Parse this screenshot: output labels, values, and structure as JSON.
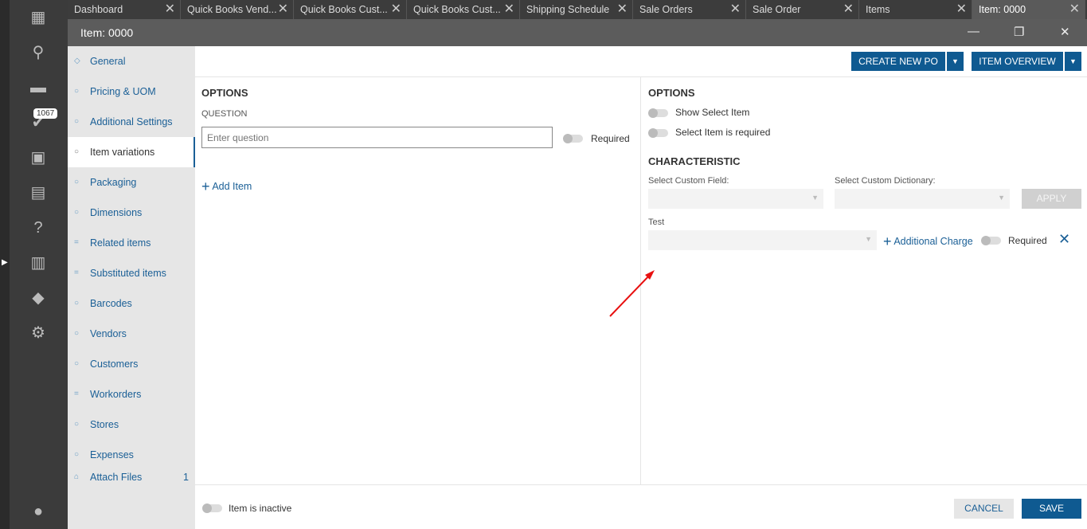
{
  "rail": {
    "badge": "1067"
  },
  "tabs": [
    "Dashboard",
    "Quick Books Vend...",
    "Quick Books Cust...",
    "Quick Books Cust...",
    "Shipping Schedule",
    "Sale Orders",
    "Sale Order",
    "Items",
    "Item: 0000"
  ],
  "window": {
    "title": "Item: 0000"
  },
  "nav": {
    "items": [
      "General",
      "Pricing & UOM",
      "Additional Settings",
      "Item variations",
      "Packaging",
      "Dimensions",
      "Related items",
      "Substituted items",
      "Barcodes",
      "Vendors",
      "Customers",
      "Workorders",
      "Stores",
      "Expenses",
      "Attach Files"
    ],
    "attach_count": "1"
  },
  "toolbar": {
    "create_po": "CREATE NEW PO",
    "item_overview": "ITEM OVERVIEW"
  },
  "left": {
    "heading": "OPTIONS",
    "question_label": "QUESTION",
    "question_placeholder": "Enter question",
    "required": "Required",
    "add_item": "Add Item"
  },
  "right": {
    "heading": "OPTIONS",
    "show_select": "Show Select Item",
    "select_required": "Select Item is required",
    "characteristic": "CHARACTERISTIC",
    "custom_field": "Select Custom Field:",
    "custom_dict": "Select Custom Dictionary:",
    "apply": "APPLY",
    "test": "Test",
    "additional_charge": "Additional Charge",
    "required": "Required"
  },
  "footer": {
    "inactive": "Item is inactive",
    "cancel": "CANCEL",
    "save": "SAVE"
  }
}
